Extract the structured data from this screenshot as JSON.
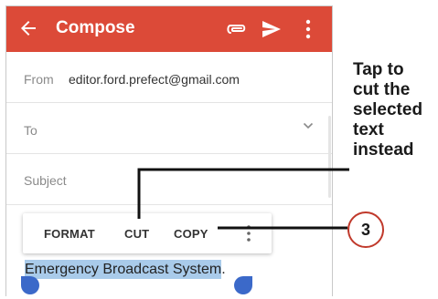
{
  "appbar": {
    "title": "Compose",
    "icons": [
      "back-arrow-icon",
      "attachment-icon",
      "send-icon",
      "more-vert-icon"
    ],
    "color": "#dc4a38"
  },
  "form": {
    "from_label": "From",
    "from_value": "editor.ford.prefect@gmail.com",
    "to_label": "To",
    "subject_label": "Subject"
  },
  "text_toolbar": {
    "format_label": "FORMAT",
    "cut_label": "CUT",
    "copy_label": "COPY"
  },
  "body": {
    "selected_text": "Emergency Broadcast System",
    "trailing_text": ".",
    "selection_color": "#a9cbea"
  },
  "callout": {
    "lines": [
      "Tap to",
      "cut the",
      "selected",
      "text",
      "instead"
    ],
    "step_number": "3",
    "badge_color": "#c0392b"
  }
}
